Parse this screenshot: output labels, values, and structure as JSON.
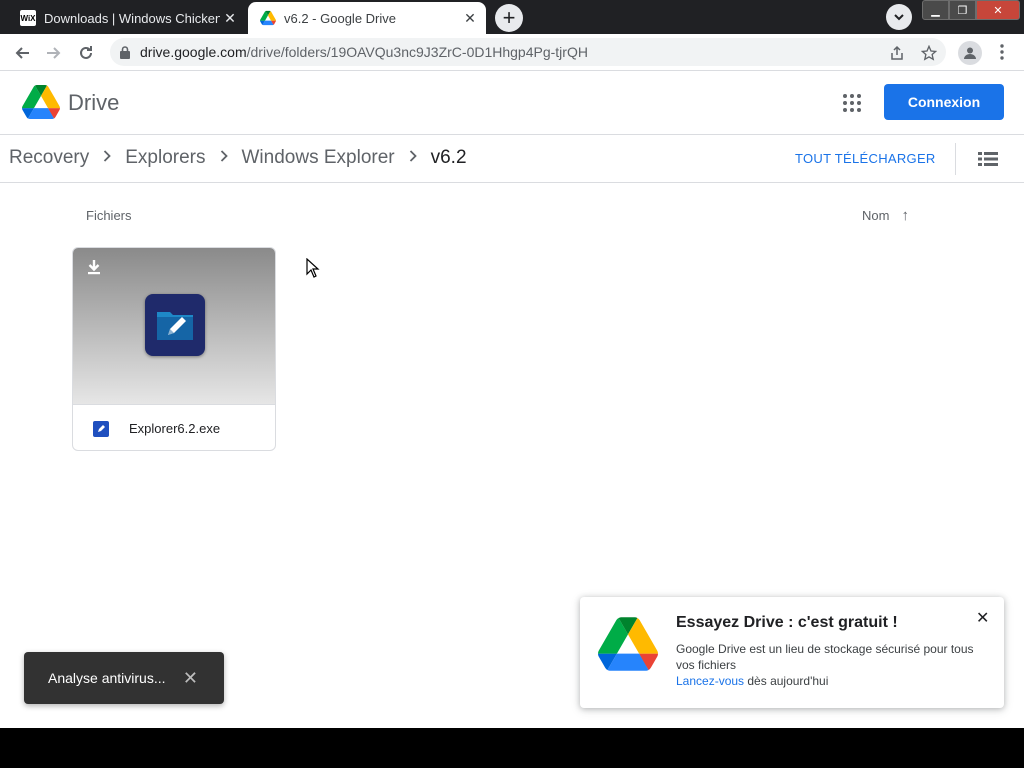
{
  "browser": {
    "tabs": [
      {
        "title": "Downloads | Windows Chicken",
        "favicon_text": "WiX",
        "active": false
      },
      {
        "title": "v6.2 - Google Drive",
        "active": true
      }
    ],
    "new_tab": "+",
    "close_glyph": "✕",
    "window_controls": {
      "minimize": "▁",
      "maximize": "❐",
      "close": "✕"
    },
    "url_host": "drive.google.com",
    "url_path": "/drive/folders/19OAVQu3nc9J3ZrC-0D1Hhgp4Pg-tjrQH"
  },
  "drive": {
    "app_name": "Drive",
    "signin_label": "Connexion",
    "breadcrumbs": [
      "Recovery",
      "Explorers",
      "Windows Explorer",
      "v6.2"
    ],
    "download_all": "TOUT TÉLÉCHARGER",
    "section_label": "Fichiers",
    "sort_label": "Nom",
    "sort_arrow": "↑",
    "files": [
      {
        "name": "Explorer6.2.exe"
      }
    ]
  },
  "snackbar": {
    "message": "Analyse antivirus...",
    "close": "✕"
  },
  "promo": {
    "title": "Essayez Drive : c'est gratuit !",
    "body": "Google Drive est un lieu de stockage sécurisé pour tous vos fichiers",
    "link": "Lancez-vous",
    "link_suffix": " dès aujourd'hui",
    "close": "✕"
  },
  "colors": {
    "accent": "#1a73e8",
    "tabstrip": "#202124",
    "snackbar": "#323232"
  }
}
